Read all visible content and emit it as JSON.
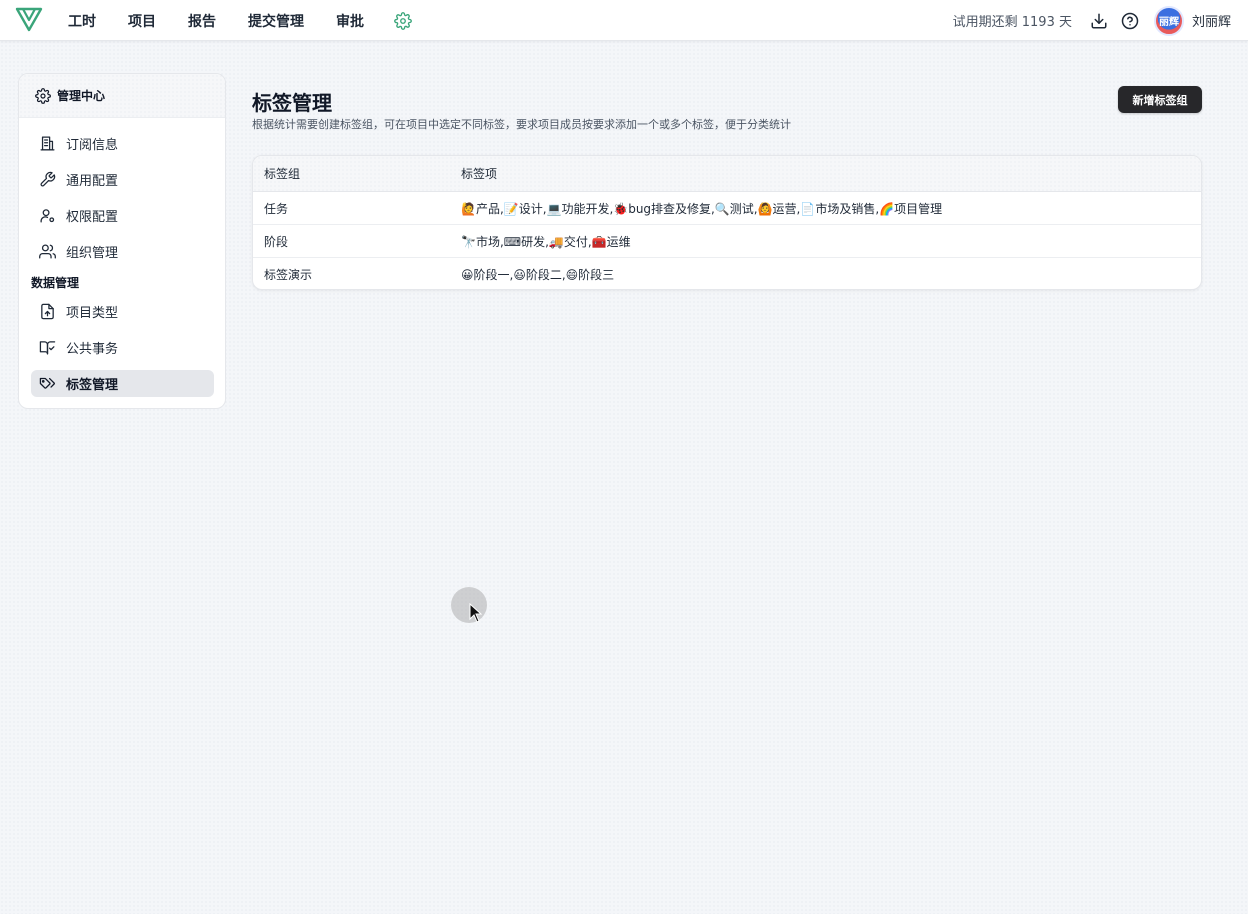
{
  "topbar": {
    "nav": [
      "工时",
      "项目",
      "报告",
      "提交管理",
      "审批"
    ],
    "trial_text": "试用期还剩 1193 天",
    "avatar_text": "丽辉",
    "username": "刘丽辉",
    "brand_color": "#3aa57a"
  },
  "sidebar": {
    "title": "管理中心",
    "items": [
      {
        "label": "订阅信息",
        "icon": "building-icon"
      },
      {
        "label": "通用配置",
        "icon": "wrench-icon"
      },
      {
        "label": "权限配置",
        "icon": "user-gear-icon"
      },
      {
        "label": "组织管理",
        "icon": "users-icon"
      }
    ],
    "group_label": "数据管理",
    "data_items": [
      {
        "label": "项目类型",
        "icon": "file-upload-icon"
      },
      {
        "label": "公共事务",
        "icon": "book-check-icon"
      },
      {
        "label": "标签管理",
        "icon": "tags-icon",
        "active": true
      }
    ]
  },
  "main": {
    "title": "标签管理",
    "description": "根据统计需要创建标签组，可在项目中选定不同标签，要求项目成员按要求添加一个或多个标签，便于分类统计",
    "add_button": "新增标签组",
    "table": {
      "headers": [
        "标签组",
        "标签项"
      ],
      "rows": [
        {
          "group": "任务",
          "items": "🙋产品,📝设计,💻功能开发,🐞bug排查及修复,🔍测试,🙆运营,📄市场及销售,🌈项目管理"
        },
        {
          "group": "阶段",
          "items": "🔭市场,⌨研发,🚚交付,🧰运维"
        },
        {
          "group": "标签演示",
          "items": "😀阶段一,😃阶段二,😄阶段三"
        }
      ]
    }
  }
}
